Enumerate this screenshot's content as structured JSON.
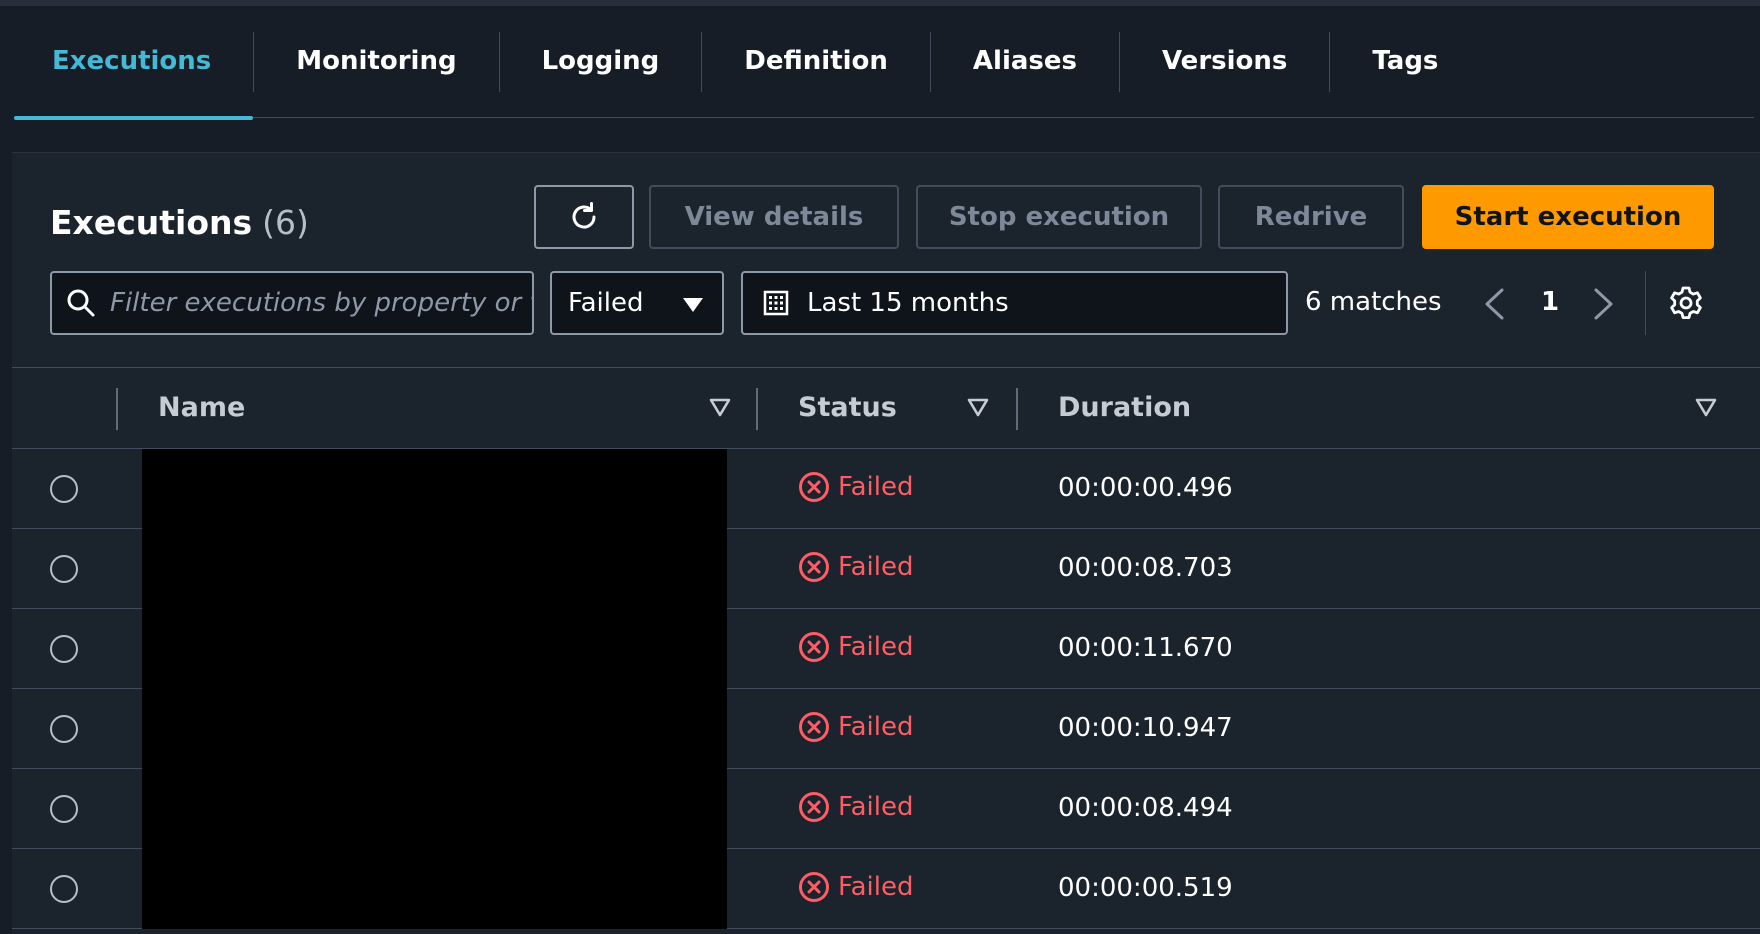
{
  "tabs": [
    {
      "label": "Executions",
      "active": true
    },
    {
      "label": "Monitoring"
    },
    {
      "label": "Logging"
    },
    {
      "label": "Definition"
    },
    {
      "label": "Aliases"
    },
    {
      "label": "Versions"
    },
    {
      "label": "Tags"
    }
  ],
  "panel": {
    "title": "Executions",
    "count": "(6)"
  },
  "toolbar": {
    "refresh_icon": "refresh-icon",
    "view_details": "View details",
    "stop_execution": "Stop execution",
    "redrive": "Redrive",
    "start_execution": "Start execution"
  },
  "filters": {
    "search_placeholder": "Filter executions by property or value",
    "status_selected": "Failed",
    "date_range": "Last 15 months",
    "matches": "6 matches",
    "page": "1"
  },
  "table": {
    "columns": [
      "Name",
      "Status",
      "Duration"
    ],
    "rows": [
      {
        "name": "",
        "status": "Failed",
        "duration": "00:00:00.496"
      },
      {
        "name": "",
        "status": "Failed",
        "duration": "00:00:08.703"
      },
      {
        "name": "",
        "status": "Failed",
        "duration": "00:00:11.670"
      },
      {
        "name": "",
        "status": "Failed",
        "duration": "00:00:10.947"
      },
      {
        "name": "",
        "status": "Failed",
        "duration": "00:00:08.494"
      },
      {
        "name": "",
        "status": "Failed",
        "duration": "00:00:00.519"
      }
    ]
  },
  "colors": {
    "accent_tab": "#44b9d6",
    "primary_button": "#ff9900",
    "status_failed": "#ff5d64",
    "background": "#161d26",
    "panel": "#1b232d"
  }
}
